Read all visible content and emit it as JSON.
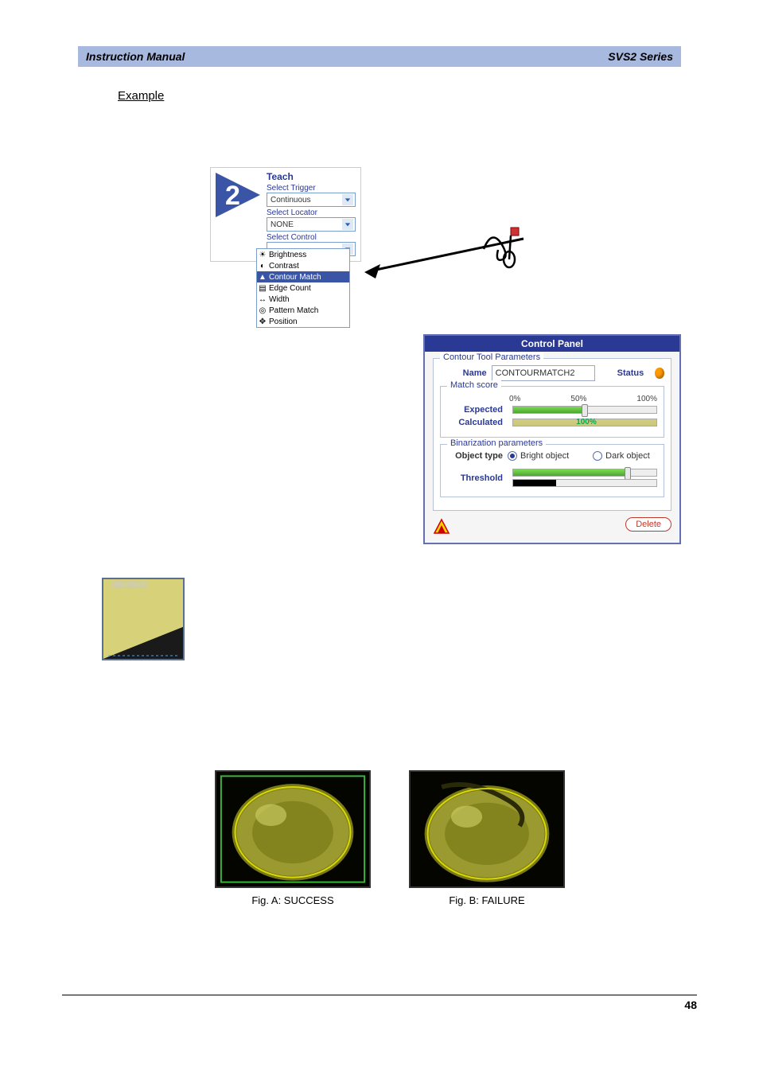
{
  "header": {
    "left": "Instruction Manual",
    "right": "SVS2 Series"
  },
  "section_title": "Example",
  "teach": {
    "title": "Teach",
    "labels": {
      "trigger": "Select Trigger",
      "locator": "Select Locator",
      "control": "Select Control"
    },
    "trigger_value": "Continuous",
    "locator_value": "NONE",
    "control_value": "",
    "tools": [
      "Brightness",
      "Contrast",
      "Contour Match",
      "Edge Count",
      "Width",
      "Pattern Match",
      "Position"
    ],
    "selected_tool_index": 2
  },
  "control_panel": {
    "title": "Control Panel",
    "section_params": "Contour Tool Parameters",
    "name_label": "Name",
    "name_value": "CONTOURMATCH2",
    "status_label": "Status",
    "section_match": "Match score",
    "scale": [
      "0%",
      "50%",
      "100%"
    ],
    "expected_label": "Expected",
    "calculated_label": "Calculated",
    "calculated_value": "100%",
    "section_bin": "Binarization parameters",
    "object_type_label": "Object type",
    "bright_label": "Bright object",
    "dark_label": "Dark object",
    "threshold_label": "Threshold",
    "delete_label": "Delete"
  },
  "fig": {
    "a": "Fig. A: SUCCESS",
    "b": "Fig. B: FAILURE"
  },
  "page_no": "48"
}
